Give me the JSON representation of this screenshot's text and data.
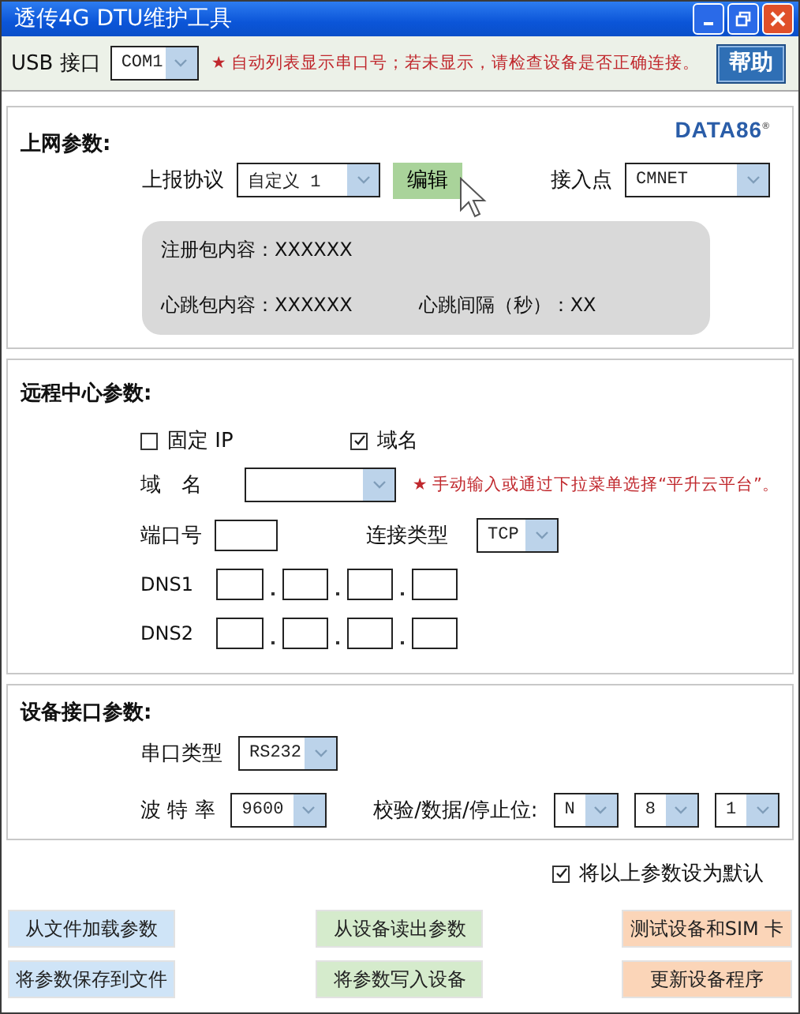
{
  "window": {
    "title": "透传4G DTU维护工具"
  },
  "usb": {
    "label": "USB 接口",
    "port": "COM1",
    "note": "★ 自动列表显示串口号；若未显示，请检查设备是否正确连接。",
    "help_button": "帮助"
  },
  "network": {
    "title": "上网参数:",
    "logo": "DATA86$^{®}$",
    "protocol_label": "上报协议",
    "protocol": "自定义 1",
    "edit_button": "编辑",
    "apn_label": "接入点",
    "apn": "CMNET",
    "info": {
      "register": "注册包内容：XXXXXX",
      "heartbeat": "心跳包内容：XXXXXX",
      "interval": "心跳间隔（秒）：XX"
    }
  },
  "remote": {
    "title": "远程中心参数:",
    "modes": [
      {
        "label": "固定 IP",
        "checked": false
      },
      {
        "label": "域名",
        "checked": true
      }
    ],
    "domain_label": "域　名",
    "domain_note": "★ 手动输入或通过下拉菜单选择“平升云平台”。",
    "port_label": "端口号",
    "conn_label": "连接类型",
    "conn": "TCP",
    "dns": [
      {
        "label": "DNS1"
      },
      {
        "label": "DNS2"
      }
    ]
  },
  "serial": {
    "title": "设备接口参数:",
    "type_label": "串口类型",
    "type": "RS232",
    "baud_label": "波 特 率",
    "baud": "9600",
    "format_label": "校验/数据/停止位:",
    "parity": "N",
    "data_bits": "8",
    "stop_bits": "1"
  },
  "default_option": {
    "label": "将以上参数设为默认",
    "checked": true
  },
  "buttons": [
    {
      "label": "从文件加载参数",
      "color": "#cfe4f7"
    },
    {
      "label": "从设备读出参数",
      "color": "#d5ebcc"
    },
    {
      "label": "测试设备和SIM 卡",
      "color": "#fbd5b8"
    },
    {
      "label": "将参数保存到文件",
      "color": "#cfe4f7"
    },
    {
      "label": "将参数写入设备",
      "color": "#d5ebcc"
    },
    {
      "label": "更新设备程序",
      "color": "#fbd5b8"
    }
  ]
}
